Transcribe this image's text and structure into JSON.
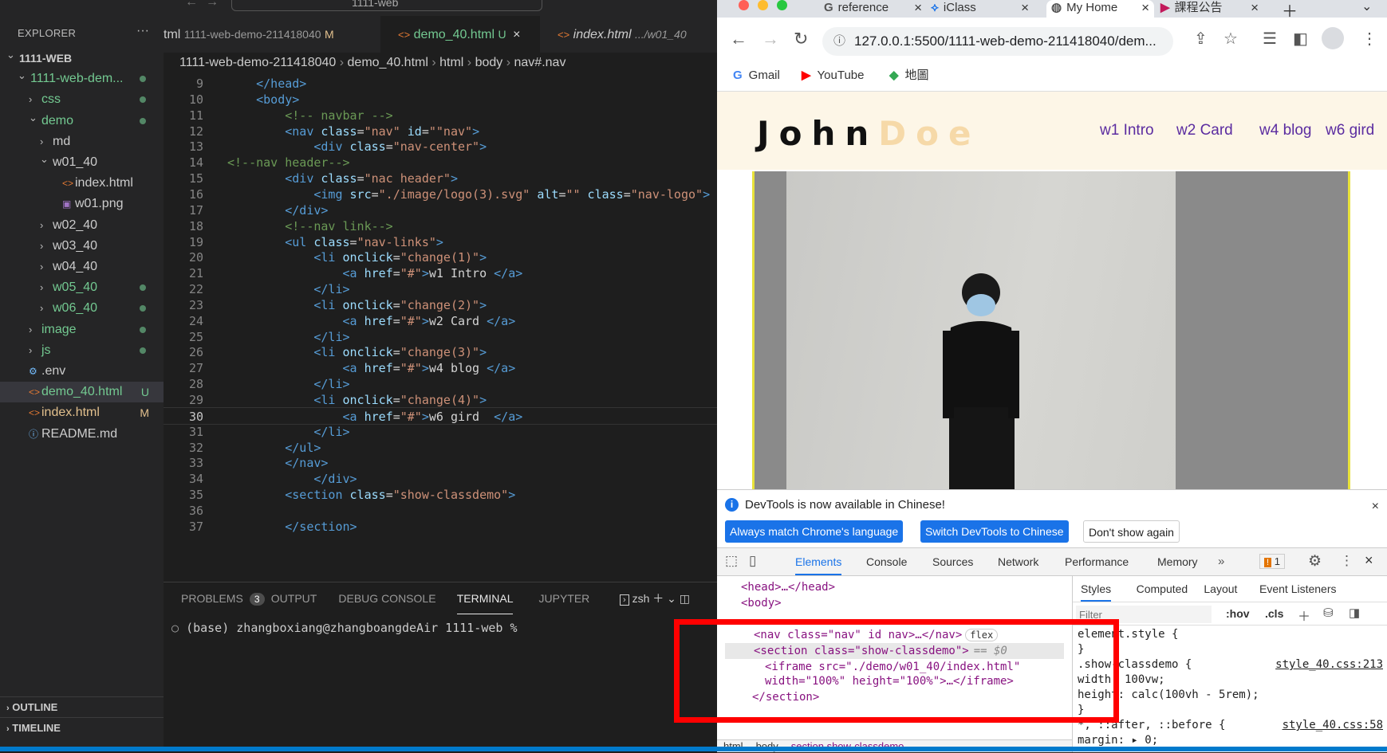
{
  "vscode": {
    "command_center": "1111-web",
    "explorer_title": "EXPLORER",
    "tree": [
      {
        "label": "1111-WEB",
        "depth": 0,
        "kind": "root",
        "open": true,
        "color": "#cccccc"
      },
      {
        "label": "1111-web-dem...",
        "depth": 1,
        "kind": "folder",
        "open": true,
        "color": "#73c991",
        "dot": true
      },
      {
        "label": "css",
        "depth": 2,
        "kind": "folder",
        "open": false,
        "color": "#73c991",
        "dot": true
      },
      {
        "label": "demo",
        "depth": 2,
        "kind": "folder",
        "open": true,
        "color": "#73c991",
        "dot": true
      },
      {
        "label": "md",
        "depth": 3,
        "kind": "folder",
        "open": false,
        "color": "#cccccc"
      },
      {
        "label": "w01_40",
        "depth": 3,
        "kind": "folder",
        "open": true,
        "color": "#cccccc"
      },
      {
        "label": "index.html",
        "depth": 4,
        "kind": "html",
        "color": "#cccccc"
      },
      {
        "label": "w01.png",
        "depth": 4,
        "kind": "image",
        "color": "#cccccc"
      },
      {
        "label": "w02_40",
        "depth": 3,
        "kind": "folder",
        "open": false,
        "color": "#cccccc"
      },
      {
        "label": "w03_40",
        "depth": 3,
        "kind": "folder",
        "open": false,
        "color": "#cccccc"
      },
      {
        "label": "w04_40",
        "depth": 3,
        "kind": "folder",
        "open": false,
        "color": "#cccccc"
      },
      {
        "label": "w05_40",
        "depth": 3,
        "kind": "folder",
        "open": false,
        "color": "#73c991",
        "dot": true
      },
      {
        "label": "w06_40",
        "depth": 3,
        "kind": "folder",
        "open": false,
        "color": "#73c991",
        "dot": true
      },
      {
        "label": "image",
        "depth": 2,
        "kind": "folder",
        "open": false,
        "color": "#73c991",
        "dot": true
      },
      {
        "label": "js",
        "depth": 2,
        "kind": "folder",
        "open": false,
        "color": "#73c991",
        "dot": true
      },
      {
        "label": ".env",
        "depth": 1,
        "kind": "gear",
        "color": "#cccccc"
      },
      {
        "label": "demo_40.html",
        "depth": 1,
        "kind": "html",
        "color": "#73c991",
        "badge": "U",
        "selected": true
      },
      {
        "label": "index.html",
        "depth": 1,
        "kind": "html",
        "color": "#e2c08d",
        "badge": "M"
      },
      {
        "label": "README.md",
        "depth": 1,
        "kind": "info",
        "color": "#cccccc"
      }
    ],
    "outline_label": "OUTLINE",
    "timeline_label": "TIMELINE",
    "tabs": [
      {
        "name": "tml",
        "path": "1111-web-demo-211418040",
        "badge": "M"
      },
      {
        "name": "demo_40.html",
        "badge": "U",
        "close": "×",
        "active": true
      },
      {
        "name": "index.html",
        "path": ".../w01_40"
      }
    ],
    "breadcrumb": [
      "1111-web-demo-211418040",
      "demo_40.html",
      "html",
      "body",
      "nav#.nav"
    ],
    "lines": [
      {
        "n": "9",
        "tokens": [
          [
            "t",
            "    </head>"
          ]
        ]
      },
      {
        "n": "10",
        "tokens": [
          [
            "t",
            "    <body>"
          ]
        ]
      },
      {
        "n": "11",
        "tokens": [
          [
            "c",
            "        <!-- navbar -->"
          ]
        ]
      },
      {
        "n": "12",
        "tokens": [
          [
            "t",
            "        <nav "
          ],
          [
            "a",
            "class"
          ],
          [
            "w",
            "="
          ],
          [
            "s",
            "\"nav\""
          ],
          [
            "a",
            " id"
          ],
          [
            "w",
            "="
          ],
          [
            "s",
            "\"\"nav\""
          ],
          [
            "t",
            ">"
          ]
        ]
      },
      {
        "n": "13",
        "tokens": [
          [
            "t",
            "            <div "
          ],
          [
            "a",
            "class"
          ],
          [
            "w",
            "="
          ],
          [
            "s",
            "\"nav-center\""
          ],
          [
            "t",
            ">"
          ]
        ]
      },
      {
        "n": "14",
        "tokens": [
          [
            "c",
            "<!--nav header-->"
          ]
        ]
      },
      {
        "n": "15",
        "tokens": [
          [
            "t",
            "        <div "
          ],
          [
            "a",
            "class"
          ],
          [
            "w",
            "="
          ],
          [
            "s",
            "\"nac header\""
          ],
          [
            "t",
            ">"
          ]
        ]
      },
      {
        "n": "16",
        "tokens": [
          [
            "t",
            "            <img "
          ],
          [
            "a",
            "src"
          ],
          [
            "w",
            "="
          ],
          [
            "s",
            "\"./image/logo(3).svg\""
          ],
          [
            "a",
            " alt"
          ],
          [
            "w",
            "="
          ],
          [
            "s",
            "\"\""
          ],
          [
            "a",
            " class"
          ],
          [
            "w",
            "="
          ],
          [
            "s",
            "\"nav-logo\""
          ],
          [
            "t",
            ">"
          ]
        ]
      },
      {
        "n": "17",
        "tokens": [
          [
            "t",
            "        </div>"
          ]
        ]
      },
      {
        "n": "18",
        "tokens": [
          [
            "c",
            "        <!--nav link-->"
          ]
        ]
      },
      {
        "n": "19",
        "tokens": [
          [
            "t",
            "        <ul "
          ],
          [
            "a",
            "class"
          ],
          [
            "w",
            "="
          ],
          [
            "s",
            "\"nav-links\""
          ],
          [
            "t",
            ">"
          ]
        ]
      },
      {
        "n": "20",
        "tokens": [
          [
            "t",
            "            <li "
          ],
          [
            "a",
            "onclick"
          ],
          [
            "w",
            "="
          ],
          [
            "s",
            "\"change(1)\""
          ],
          [
            "t",
            ">"
          ]
        ]
      },
      {
        "n": "21",
        "tokens": [
          [
            "t",
            "                <a "
          ],
          [
            "a",
            "href"
          ],
          [
            "w",
            "="
          ],
          [
            "s",
            "\"#\""
          ],
          [
            "t",
            ">"
          ],
          [
            "w",
            "w1 Intro "
          ],
          [
            "t",
            "</a>"
          ]
        ]
      },
      {
        "n": "22",
        "tokens": [
          [
            "t",
            "            </li>"
          ]
        ]
      },
      {
        "n": "23",
        "tokens": [
          [
            "t",
            "            <li "
          ],
          [
            "a",
            "onclick"
          ],
          [
            "w",
            "="
          ],
          [
            "s",
            "\"change(2)\""
          ],
          [
            "t",
            ">"
          ]
        ]
      },
      {
        "n": "24",
        "tokens": [
          [
            "t",
            "                <a "
          ],
          [
            "a",
            "href"
          ],
          [
            "w",
            "="
          ],
          [
            "s",
            "\"#\""
          ],
          [
            "t",
            ">"
          ],
          [
            "w",
            "w2 Card "
          ],
          [
            "t",
            "</a>"
          ]
        ]
      },
      {
        "n": "25",
        "tokens": [
          [
            "t",
            "            </li>"
          ]
        ]
      },
      {
        "n": "26",
        "tokens": [
          [
            "t",
            "            <li "
          ],
          [
            "a",
            "onclick"
          ],
          [
            "w",
            "="
          ],
          [
            "s",
            "\"change(3)\""
          ],
          [
            "t",
            ">"
          ]
        ]
      },
      {
        "n": "27",
        "tokens": [
          [
            "t",
            "                <a "
          ],
          [
            "a",
            "href"
          ],
          [
            "w",
            "="
          ],
          [
            "s",
            "\"#\""
          ],
          [
            "t",
            ">"
          ],
          [
            "w",
            "w4 blog "
          ],
          [
            "t",
            "</a>"
          ]
        ]
      },
      {
        "n": "28",
        "tokens": [
          [
            "t",
            "            </li>"
          ]
        ]
      },
      {
        "n": "29",
        "tokens": [
          [
            "t",
            "            <li "
          ],
          [
            "a",
            "onclick"
          ],
          [
            "w",
            "="
          ],
          [
            "s",
            "\"change(4)\""
          ],
          [
            "t",
            ">"
          ]
        ]
      },
      {
        "n": "30",
        "tokens": [
          [
            "t",
            "                <a "
          ],
          [
            "a",
            "href"
          ],
          [
            "w",
            "="
          ],
          [
            "s",
            "\"#\""
          ],
          [
            "t",
            ">"
          ],
          [
            "w",
            "w6 gird  "
          ],
          [
            "t",
            "</a>"
          ]
        ],
        "current": true
      },
      {
        "n": "31",
        "tokens": [
          [
            "t",
            "            </li>"
          ]
        ]
      },
      {
        "n": "32",
        "tokens": [
          [
            "t",
            "        </ul>"
          ]
        ]
      },
      {
        "n": "33",
        "tokens": [
          [
            "t",
            "        </nav>"
          ]
        ]
      },
      {
        "n": "34",
        "tokens": [
          [
            "t",
            "            </div>"
          ]
        ]
      },
      {
        "n": "35",
        "tokens": [
          [
            "t",
            "        <section "
          ],
          [
            "a",
            "class"
          ],
          [
            "w",
            "="
          ],
          [
            "s",
            "\"show-classdemo\""
          ],
          [
            "t",
            ">"
          ]
        ]
      },
      {
        "n": "36",
        "tokens": [
          [
            "w",
            ""
          ]
        ]
      },
      {
        "n": "37",
        "tokens": [
          [
            "t",
            "        </section>"
          ]
        ]
      }
    ],
    "panel_tabs": [
      {
        "label": "PROBLEMS",
        "count": "3"
      },
      {
        "label": "OUTPUT"
      },
      {
        "label": "DEBUG CONSOLE"
      },
      {
        "label": "TERMINAL",
        "active": true
      },
      {
        "label": "JUPYTER"
      }
    ],
    "shell": "zsh",
    "terminal_prompt": "(base) zhangboxiang@zhangboangdeAir 1111-web %"
  },
  "browser": {
    "tabs": [
      {
        "title": "reference",
        "icon": "G"
      },
      {
        "title": "iClass",
        "icon": "⟡"
      },
      {
        "title": "My Home",
        "icon": "◍",
        "active": true
      },
      {
        "title": "課程公告",
        "icon": "▶"
      }
    ],
    "url": "127.0.0.1:5500/1111-web-demo-211418040/dem...",
    "bookmarks": [
      {
        "label": "Gmail",
        "icon": "G"
      },
      {
        "label": "YouTube",
        "icon": "▶"
      },
      {
        "label": "地圖",
        "icon": "◆"
      }
    ],
    "site": {
      "logo_first": "John",
      "logo_last": "Doe",
      "links": [
        "w1 Intro",
        "w2 Card",
        "w4 blog",
        "w6 gird"
      ]
    },
    "devtools": {
      "notice": "DevTools is now available in Chinese!",
      "btn_match": "Always match Chrome's language",
      "btn_switch": "Switch DevTools to Chinese",
      "btn_dont": "Don't show again",
      "tabs": [
        "Elements",
        "Console",
        "Sources",
        "Network",
        "Performance",
        "Memory"
      ],
      "issues": "1",
      "dom": [
        {
          "kind": "text",
          "text": "<head>…</head>"
        },
        {
          "kind": "text",
          "text": "<body>"
        },
        {
          "kind": "text",
          "text": "<nav class=\"nav\" id nav>…</nav>",
          "badge": "flex"
        },
        {
          "kind": "text",
          "text": "<section class=\"show-classdemo\">",
          "suffix": "== $0",
          "selected": true
        },
        {
          "kind": "text",
          "text": "<iframe src=\"./demo/w01_40/index.html\""
        },
        {
          "kind": "text",
          "text": "width=\"100%\" height=\"100%\">…</iframe>"
        },
        {
          "kind": "text",
          "text": "</section>"
        }
      ],
      "styles_tabs": [
        "Styles",
        "Computed",
        "Layout",
        "Event Listeners"
      ],
      "filter_placeholder": "Filter",
      "hov": ":hov",
      "cls": ".cls",
      "rules": [
        {
          "text": "element.style {",
          "src": ""
        },
        {
          "text": "}",
          "src": ""
        },
        {
          "text": ".show-classdemo {",
          "src": "style_40.css:213"
        },
        {
          "text": "  width: 100vw;",
          "src": ""
        },
        {
          "text": "  height: calc(100vh - 5rem);",
          "src": ""
        },
        {
          "text": "}",
          "src": ""
        },
        {
          "text": "*, ::after, ::before {",
          "src": "style_40.css:58"
        },
        {
          "text": "  margin: ▸ 0;",
          "src": ""
        }
      ],
      "crumbs": [
        "html",
        "body",
        "section.show-classdemo"
      ]
    }
  }
}
